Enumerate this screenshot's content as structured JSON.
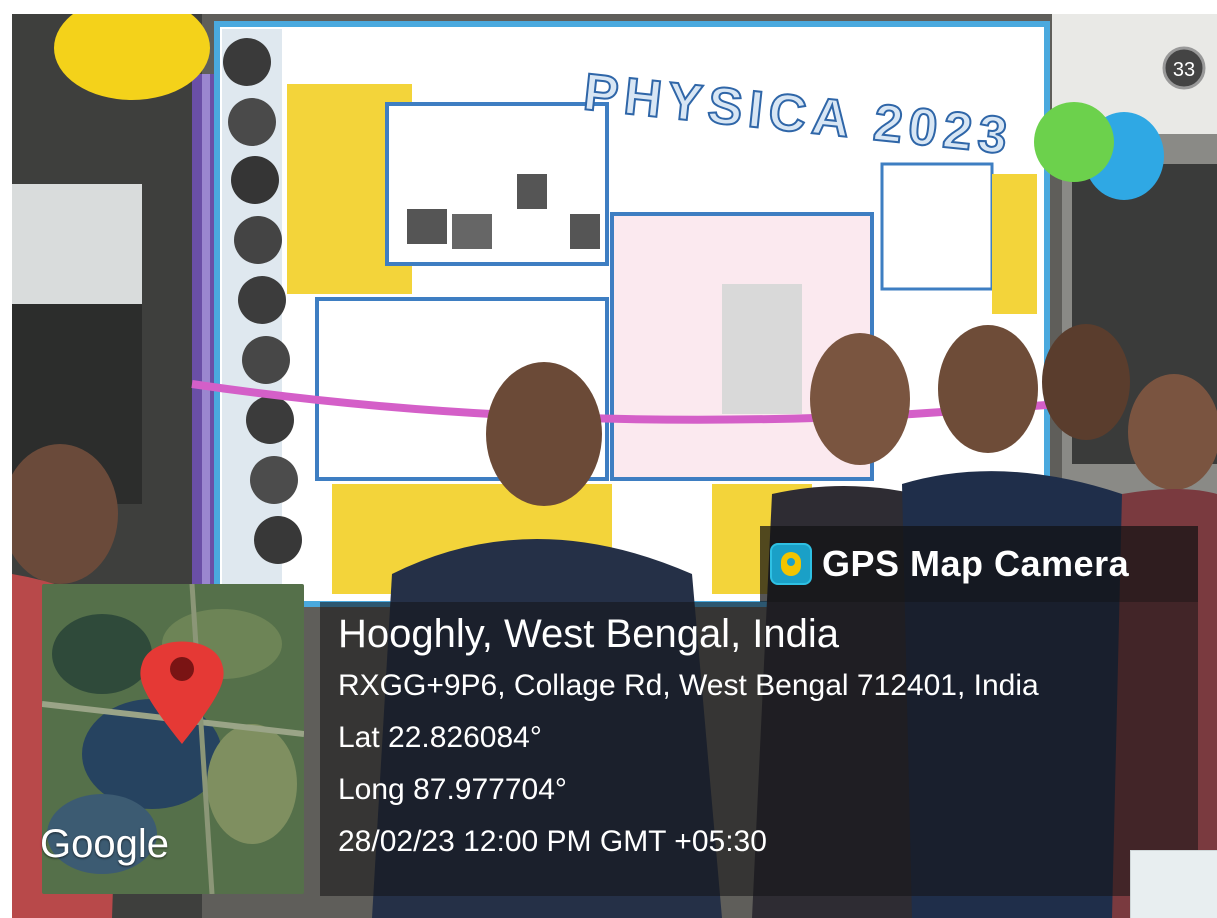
{
  "photo": {
    "banner_text": "PHYSICA 2023",
    "room_number": "33"
  },
  "gps_overlay": {
    "app_title": "GPS Map Camera",
    "place": "Hooghly, West Bengal, India",
    "address": "RXGG+9P6, Collage Rd, West Bengal 712401, India",
    "latitude": "Lat 22.826084°",
    "longitude": "Long 87.977704°",
    "timestamp": "28/02/23 12:00 PM GMT +05:30",
    "map_brand": "Google",
    "icons": [
      "gps-map-camera-app-icon",
      "map-pin-icon"
    ]
  },
  "colors": {
    "pin": "#e53935",
    "overlay": "#141416",
    "app_icon": "#1aa0c7"
  }
}
